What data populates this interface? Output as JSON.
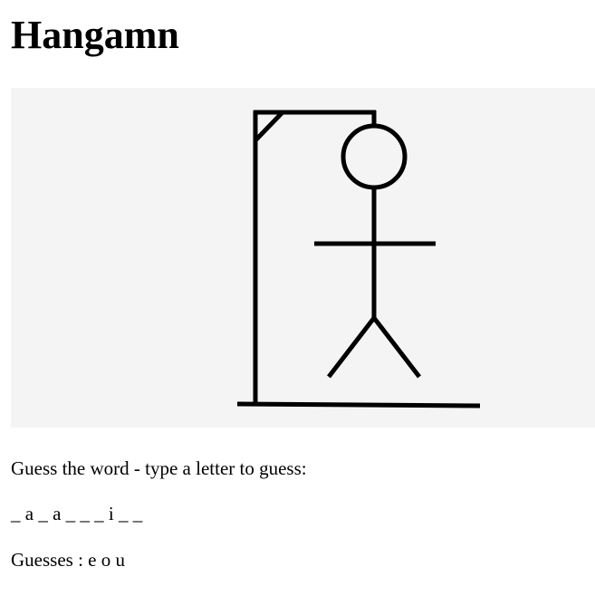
{
  "page": {
    "title": "Hangamn"
  },
  "hangman": {
    "image": "hangman-figure",
    "background": "#f4f4f4",
    "stroke": "#000000",
    "parts_shown": [
      "gallows",
      "head",
      "body",
      "arms",
      "legs"
    ]
  },
  "game": {
    "instructions": "Guess the word - type a letter to guess:",
    "word_display": "_ a _ a _ _ _ i _ _",
    "guesses_label": "Guesses :",
    "guessed_letters": "e o u"
  }
}
